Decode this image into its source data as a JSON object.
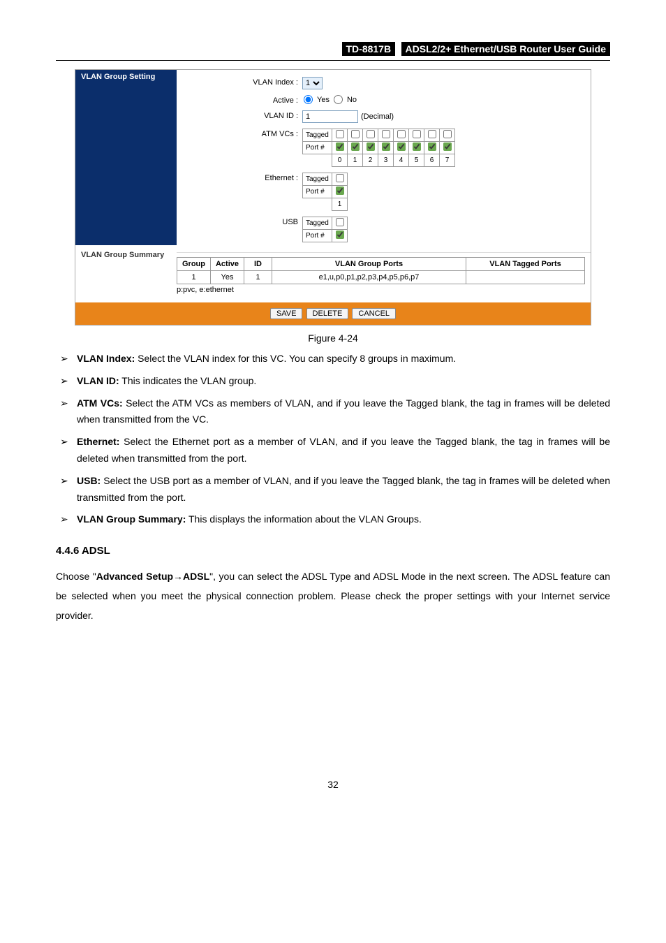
{
  "header": {
    "model": "TD-8817B",
    "title": "ADSL2/2+  Ethernet/USB  Router  User  Guide"
  },
  "vlan_group_setting": {
    "heading": "VLAN Group Setting",
    "labels": {
      "vlan_index": "VLAN Index :",
      "active": "Active :",
      "vlan_id": "VLAN ID :",
      "atm_vcs": "ATM VCs :",
      "ethernet": "Ethernet :",
      "usb": "USB"
    },
    "vlan_index_value": "1",
    "active_yes": "Yes",
    "active_no": "No",
    "vlan_id_value": "1",
    "decimal_hint": "(Decimal)",
    "tagged_label": "Tagged",
    "port_label": "Port #",
    "atm_ports": [
      "0",
      "1",
      "2",
      "3",
      "4",
      "5",
      "6",
      "7"
    ],
    "eth_ports": [
      "1"
    ]
  },
  "vlan_group_summary": {
    "heading": "VLAN Group Summary",
    "columns": {
      "group": "Group",
      "active": "Active",
      "id": "ID",
      "ports": "VLAN Group Ports",
      "tagged": "VLAN Tagged Ports"
    },
    "rows": [
      {
        "group": "1",
        "active": "Yes",
        "id": "1",
        "ports": "e1,u,p0,p1,p2,p3,p4,p5,p6,p7",
        "tagged": ""
      }
    ],
    "legend": "p:pvc, e:ethernet"
  },
  "buttons": {
    "save": "SAVE",
    "delete": "DELETE",
    "cancel": "CANCEL"
  },
  "figure_caption": "Figure 4-24",
  "notes": [
    {
      "label": "VLAN Index:",
      "text": " Select the VLAN index for this VC. You can specify 8 groups in maximum."
    },
    {
      "label": "VLAN ID:",
      "text": " This indicates the VLAN group."
    },
    {
      "label": "ATM VCs:",
      "text": " Select the ATM VCs as members of VLAN, and if you leave the Tagged blank, the tag in frames will be deleted when transmitted from the VC."
    },
    {
      "label": "Ethernet:",
      "text": " Select the Ethernet port as a member of VLAN, and if you leave the Tagged blank, the tag in frames will be deleted when transmitted from the port."
    },
    {
      "label": "USB:",
      "text": " Select the USB port as a member of VLAN, and if you leave the Tagged blank, the tag in frames will be deleted when transmitted from the port."
    },
    {
      "label": "VLAN Group Summary:",
      "text": " This displays the information about the VLAN Groups."
    }
  ],
  "section": {
    "number_title": "4.4.6  ADSL",
    "body_pre": "Choose \"",
    "body_bold": "Advanced Setup→ADSL",
    "body_post": "\", you can select the ADSL Type and ADSL Mode in the next screen. The ADSL feature can be selected when you meet the physical connection problem. Please check the proper settings with your Internet service provider."
  },
  "page_number": "32"
}
